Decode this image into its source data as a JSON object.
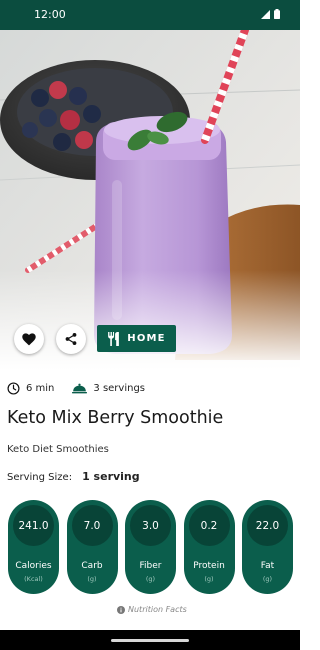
{
  "status_bar": {
    "time": "12:00"
  },
  "actions": {
    "home_label": "HOME"
  },
  "recipe": {
    "prep_time": "6 min",
    "servings": "3 servings",
    "title": "Keto Mix Berry Smoothie",
    "category": "Keto Diet Smoothies",
    "serving_size_label": "Serving Size:",
    "serving_size_value": "1 serving"
  },
  "nutrition": [
    {
      "value": "241.0",
      "label": "Calories",
      "unit": "(Kcal)"
    },
    {
      "value": "7.0",
      "label": "Carb",
      "unit": "(g)"
    },
    {
      "value": "3.0",
      "label": "Fiber",
      "unit": "(g)"
    },
    {
      "value": "0.2",
      "label": "Protein",
      "unit": "(g)"
    },
    {
      "value": "22.0",
      "label": "Fat",
      "unit": "(g)"
    }
  ],
  "footer": {
    "note": "Nutrition Facts"
  },
  "colors": {
    "primary": "#0b5e4c",
    "status_bar": "#0b4d3f",
    "circle": "#084437"
  }
}
